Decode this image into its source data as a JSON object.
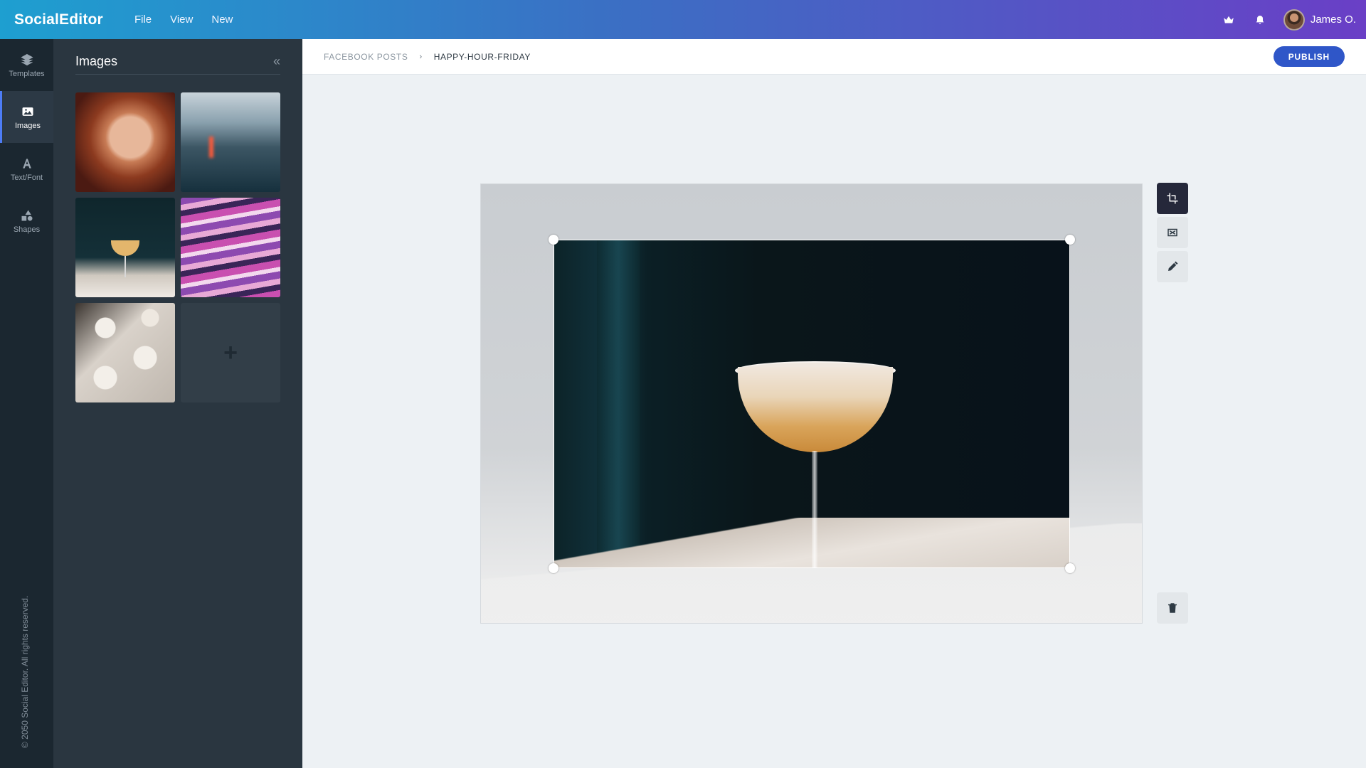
{
  "app": {
    "title": "SocialEditor",
    "menu": [
      "File",
      "View",
      "New"
    ],
    "user_name": "James O."
  },
  "rail": {
    "items": [
      {
        "label": "Templates",
        "icon": "layers-icon"
      },
      {
        "label": "Images",
        "icon": "image-icon",
        "active": true
      },
      {
        "label": "Text/Font",
        "icon": "text-icon"
      },
      {
        "label": "Shapes",
        "icon": "shapes-icon"
      }
    ],
    "copyright": "© 2050 Social Editor. All rights reserved."
  },
  "panel": {
    "title": "Images",
    "collapse_glyph": "«",
    "add_glyph": "+"
  },
  "breadcrumb": {
    "parent": "FACEBOOK POSTS",
    "separator": "›",
    "current": "HAPPY-HOUR-FRIDAY"
  },
  "actions": {
    "publish_label": "PUBLISH"
  },
  "tools": [
    "crop-icon",
    "replace-image-icon",
    "pencil-icon",
    "trash-icon"
  ],
  "colors": {
    "accent": "#2f56c8",
    "active_tool": "#25283a",
    "rail_bg": "#1b2730",
    "panel_bg": "#2a3640"
  }
}
